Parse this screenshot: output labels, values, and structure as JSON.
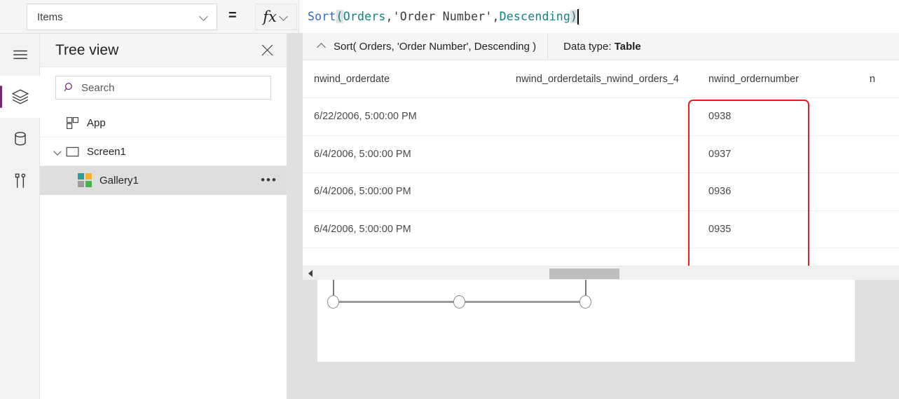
{
  "topbar": {
    "property_select": {
      "value": "Items",
      "chevron_icon": "chevron-down-icon"
    },
    "equals_label": "=",
    "fx_button": {
      "glyph": "fx",
      "chevron_icon": "chevron-down-icon"
    },
    "formula_tokens": [
      {
        "text": "Sort",
        "kind": "function"
      },
      {
        "text": "(",
        "kind": "paren-highlight"
      },
      {
        "text": " ",
        "kind": "punct"
      },
      {
        "text": "Orders",
        "kind": "identifier"
      },
      {
        "text": ", ",
        "kind": "punct"
      },
      {
        "text": "'Order Number'",
        "kind": "string"
      },
      {
        "text": ", ",
        "kind": "punct"
      },
      {
        "text": "Descending",
        "kind": "identifier"
      },
      {
        "text": " ",
        "kind": "punct"
      },
      {
        "text": ")",
        "kind": "paren-highlight"
      }
    ],
    "formula_plain": "Sort( Orders, 'Order Number', Descending )"
  },
  "rail": {
    "items": [
      {
        "icon": "hamburger-menu-icon",
        "name": "menu",
        "active": false
      },
      {
        "icon": "layers-icon",
        "name": "tree-view",
        "active": true
      },
      {
        "icon": "database-icon",
        "name": "data",
        "active": false
      },
      {
        "icon": "media-tools-icon",
        "name": "media",
        "active": false
      }
    ]
  },
  "treeview": {
    "title": "Tree view",
    "close_icon": "close-icon",
    "search": {
      "placeholder": "Search",
      "value": "",
      "icon": "search-icon"
    },
    "items": [
      {
        "label": "App",
        "icon": "app-grid-icon",
        "indent": 1,
        "expandable": false,
        "selected": false,
        "overflow": false
      },
      {
        "label": "Screen1",
        "icon": "screen-icon",
        "indent": 1,
        "expandable": true,
        "selected": false,
        "overflow": false
      },
      {
        "label": "Gallery1",
        "icon": "gallery-icon",
        "indent": 2,
        "expandable": false,
        "selected": true,
        "overflow": true,
        "overflow_label": "•••"
      }
    ]
  },
  "result_pane": {
    "header": {
      "collapse_icon": "chevron-up-icon",
      "formula_summary": "Sort( Orders, 'Order Number', Descending )",
      "data_type_label": "Data type:",
      "data_type_value": "Table"
    },
    "columns": [
      "nwind_orderdate",
      "nwind_orderdetails_nwind_orders_4",
      "nwind_ordernumber",
      "n"
    ],
    "rows": [
      [
        "6/22/2006, 5:00:00 PM",
        "",
        "0938",
        ""
      ],
      [
        "6/4/2006, 5:00:00 PM",
        "",
        "0937",
        ""
      ],
      [
        "6/4/2006, 5:00:00 PM",
        "",
        "0936",
        ""
      ],
      [
        "6/4/2006, 5:00:00 PM",
        "",
        "0935",
        ""
      ]
    ],
    "highlight": {
      "column": "nwind_ordernumber",
      "color": "#f01c1c"
    }
  },
  "scrollbar": {
    "left_arrow_icon": "scroll-left-arrow-icon",
    "orientation": "horizontal"
  },
  "canvas": {
    "selection": {
      "handle_icon": "resize-handle-icon",
      "handles": 3
    }
  },
  "colors": {
    "accent_purple": "#742774",
    "highlight_red": "#f01c1c",
    "formula_function": "#316ac5",
    "formula_identifier": "#0c8484"
  }
}
